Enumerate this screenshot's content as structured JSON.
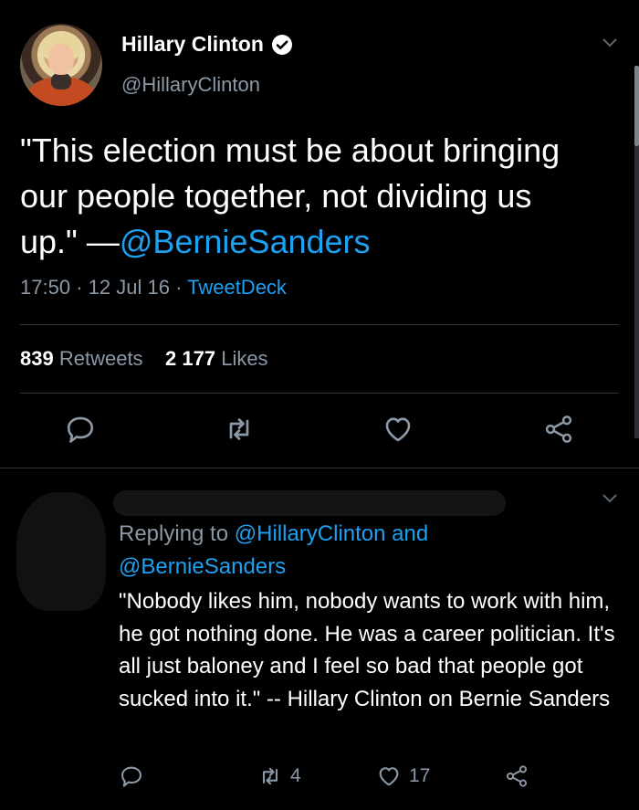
{
  "tweet": {
    "name": "Hillary Clinton",
    "handle": "@HillaryClinton",
    "text_lines": [
      "\"This election must be about bringing",
      "our people together, not dividing us",
      "up.\" —"
    ],
    "mention": "@BernieSanders",
    "time": "17:50",
    "dot1": "·",
    "date": "12 Jul 16",
    "dot2": "·",
    "source": "TweetDeck",
    "retweets_count": "839",
    "retweets_label": "Retweets",
    "likes_count": "2 177",
    "likes_label": "Likes",
    "icons": [
      "verified-badge-icon",
      "chevron-down-icon",
      "reply-icon",
      "retweet-icon",
      "like-icon",
      "share-icon"
    ]
  },
  "reply": {
    "replying_prefix": "Replying to",
    "replying_mention1": "@HillaryClinton",
    "replying_and": "and",
    "replying_mention2": "@BernieSanders",
    "text": "\"Nobody likes him, nobody wants to work with him, he got nothing done. He was a career politician. It's all just baloney and I feel so bad that people got sucked into it.\" -- Hillary Clinton on Bernie Sanders",
    "retweet_count": "4",
    "like_count": "17"
  },
  "colors": {
    "background": "#000000",
    "accent": "#1da1f2",
    "muted": "#8b98a5",
    "divider": "#2f3336"
  }
}
